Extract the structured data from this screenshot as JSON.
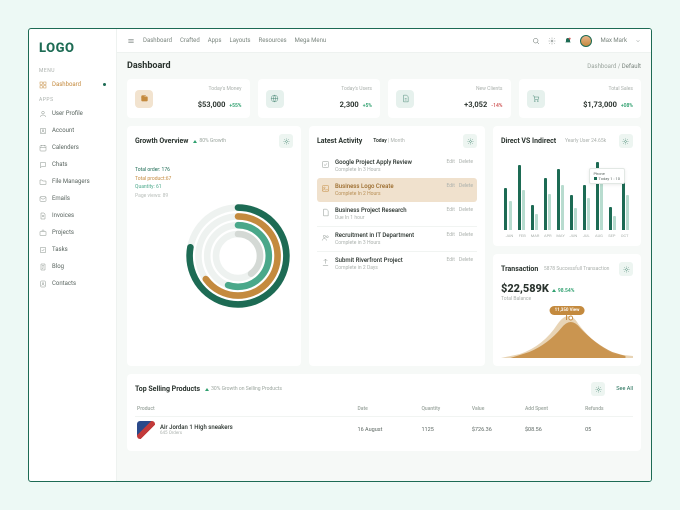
{
  "brand": "LOGO",
  "topnav": [
    "Dashboard",
    "Crafted",
    "Apps",
    "Layouts",
    "Resources",
    "Mega Menu"
  ],
  "user": "Max Mark",
  "sidebar": {
    "menu_hdr": "MENU",
    "apps_hdr": "APPS",
    "dashboard": "Dashboard",
    "items": [
      "User Profile",
      "Account",
      "Calenders",
      "Chats",
      "File Managers",
      "Emails",
      "Invoices",
      "Projects",
      "Tasks",
      "Blog",
      "Contacts"
    ]
  },
  "page": {
    "title": "Dashboard",
    "crumb_root": "Dashboard",
    "crumb_sep": "/",
    "crumb_cur": "Default"
  },
  "stats": [
    {
      "label": "Today's Money",
      "value": "$53,000",
      "delta": "+55%",
      "dir": "up"
    },
    {
      "label": "Today's Users",
      "value": "2,300",
      "delta": "+5%",
      "dir": "up"
    },
    {
      "label": "New Clients",
      "value": "+3,052",
      "delta": "-14%",
      "dir": "dn"
    },
    {
      "label": "Total Sales",
      "value": "$1,73,000",
      "delta": "+08%",
      "dir": "up"
    }
  ],
  "growth": {
    "title": "Growth Overview",
    "badge": "80% Growth",
    "labels": {
      "order": "Total order: 176",
      "product": "Total product:67",
      "qty": "Quantity: 61",
      "views": "Page views: 89"
    }
  },
  "activity": {
    "title": "Latest Activity",
    "tab_today": "Today",
    "tab_month": "Month",
    "edit": "Edit",
    "del": "Delete",
    "items": [
      {
        "t": "Google Project Apply Review",
        "s": "Complete In 3 Hours"
      },
      {
        "t": "Business Logo Create",
        "s": "Complete In 2 Hours"
      },
      {
        "t": "Business Project Research",
        "s": "Due In 1 hour"
      },
      {
        "t": "Recruitment in IT Department",
        "s": "Complete in 3 Hours"
      },
      {
        "t": "Submit Riverfront Project",
        "s": "Complete in 2 Days"
      }
    ]
  },
  "dvi": {
    "title": "Direct VS Indirect",
    "yearly": "Yearly User 24.65k",
    "tooltip_t": "Phone",
    "tooltip_v": "Today 1 : 10",
    "months": [
      "JAN",
      "FEB",
      "MAR",
      "APR",
      "MAY",
      "JUN",
      "JUL",
      "AUG",
      "SEP",
      "OCT"
    ]
  },
  "trans": {
    "title": "Transaction",
    "sub": "5878 Successfull Transaction",
    "value": "$22,589K",
    "pct": "98.54%",
    "balance": "Total Balance",
    "pill": "11,350 View"
  },
  "tsp": {
    "title": "Top Selling Products",
    "badge": "30% Growth on Selling Products",
    "see": "See All",
    "cols": [
      "Product",
      "Date",
      "Quantity",
      "Value",
      "Add Spent",
      "Refunds"
    ],
    "row": {
      "name": "Air Jordan 1 High sneakers",
      "orders": "645 Orders",
      "date": "16 August",
      "qty": "1125",
      "value": "$726.36",
      "spent": "$08.56",
      "refunds": "05"
    }
  },
  "chart_data": [
    {
      "type": "pie",
      "title": "Growth Overview",
      "series": [
        {
          "name": "Total order",
          "value": 176,
          "pct": 78,
          "color": "#1d6b54"
        },
        {
          "name": "Total product",
          "value": 67,
          "pct": 65,
          "color": "#c48a3e"
        },
        {
          "name": "Quantity",
          "value": 61,
          "pct": 55,
          "color": "#4aa88a"
        },
        {
          "name": "Page views",
          "value": 89,
          "pct": 40,
          "color": "#d4d9d5"
        }
      ]
    },
    {
      "type": "bar",
      "title": "Direct VS Indirect",
      "ylim": [
        0,
        100
      ],
      "categories": [
        "JAN",
        "FEB",
        "MAR",
        "APR",
        "MAY",
        "JUN",
        "JUL",
        "AUG",
        "SEP",
        "OCT"
      ],
      "series": [
        {
          "name": "Direct",
          "color": "#1d6b54",
          "values": [
            58,
            90,
            35,
            72,
            85,
            48,
            62,
            95,
            32,
            70
          ]
        },
        {
          "name": "Indirect",
          "color": "#b8dccf",
          "values": [
            40,
            55,
            22,
            50,
            62,
            30,
            44,
            68,
            20,
            48
          ]
        }
      ]
    },
    {
      "type": "area",
      "title": "Transaction",
      "x": [
        0,
        1,
        2,
        3,
        4,
        5,
        6,
        7,
        8,
        9
      ],
      "series": [
        {
          "name": "A",
          "color": "#c48a3e",
          "values": [
            5,
            8,
            14,
            32,
            48,
            42,
            30,
            22,
            18,
            14
          ]
        },
        {
          "name": "B",
          "color": "#e8d4b5",
          "values": [
            2,
            4,
            8,
            18,
            30,
            26,
            18,
            12,
            8,
            5
          ]
        }
      ]
    }
  ]
}
